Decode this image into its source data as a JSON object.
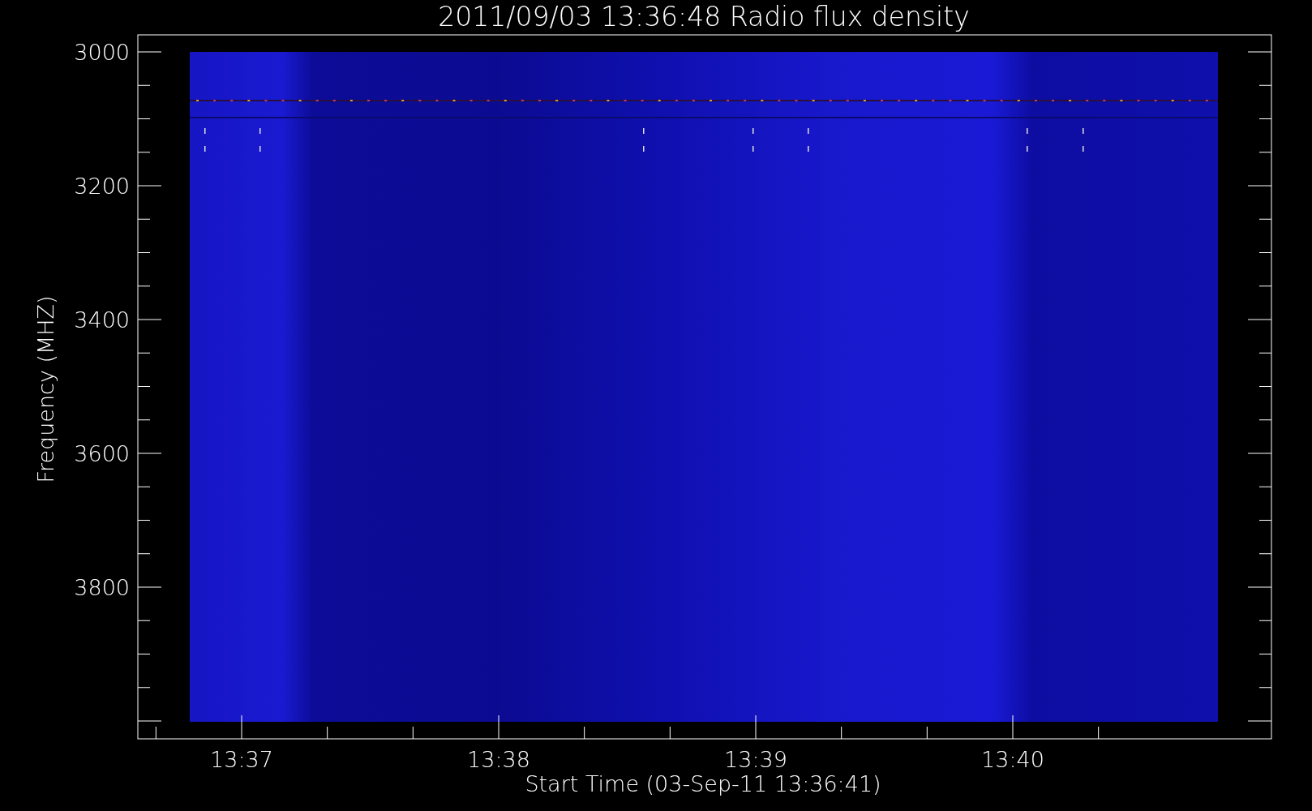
{
  "title": "2011/09/03 13:36:48 Radio flux density",
  "y_axis": {
    "label": "Frequency (MHZ)",
    "ticks": [
      "3000",
      "3200",
      "3400",
      "3600",
      "3800"
    ]
  },
  "x_axis": {
    "label": "Start Time (03-Sep-11 13:36:41)",
    "ticks": [
      "13:37",
      "13:38",
      "13:39",
      "13:40"
    ]
  }
}
